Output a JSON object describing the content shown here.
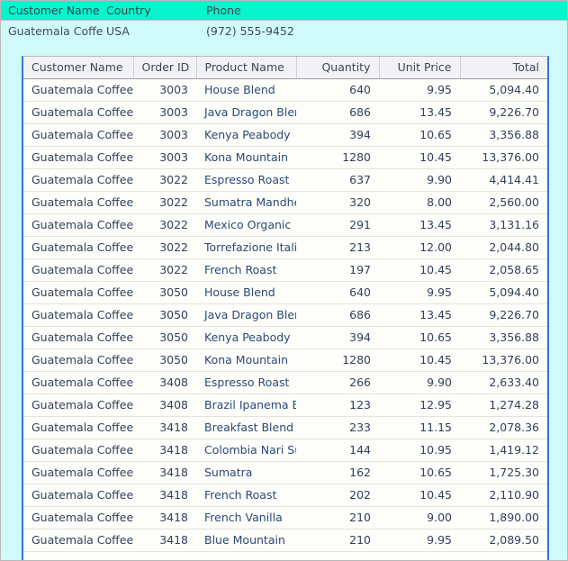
{
  "master": {
    "columns": [
      "Customer Name",
      "Country",
      "Phone"
    ],
    "row": {
      "customer_name": "Guatemala Coffee",
      "country": "USA",
      "phone": "(972) 555-9452"
    }
  },
  "detail": {
    "columns": [
      "Customer Name",
      "Order ID",
      "Product Name",
      "Quantity",
      "Unit Price",
      "Total"
    ],
    "rows": [
      {
        "customer": "Guatemala Coffee",
        "order_id": "3003",
        "product": "House Blend",
        "quantity": "640",
        "unit_price": "9.95",
        "total": "5,094.40"
      },
      {
        "customer": "Guatemala Coffee",
        "order_id": "3003",
        "product": "Java Dragon Blend",
        "quantity": "686",
        "unit_price": "13.45",
        "total": "9,226.70"
      },
      {
        "customer": "Guatemala Coffee",
        "order_id": "3003",
        "product": "Kenya Peabody",
        "quantity": "394",
        "unit_price": "10.65",
        "total": "3,356.88"
      },
      {
        "customer": "Guatemala Coffee",
        "order_id": "3003",
        "product": "Kona Mountain",
        "quantity": "1280",
        "unit_price": "10.45",
        "total": "13,376.00"
      },
      {
        "customer": "Guatemala Coffee",
        "order_id": "3022",
        "product": "Espresso Roast",
        "quantity": "637",
        "unit_price": "9.90",
        "total": "4,414.41"
      },
      {
        "customer": "Guatemala Coffee",
        "order_id": "3022",
        "product": "Sumatra Mandheli",
        "quantity": "320",
        "unit_price": "8.00",
        "total": "2,560.00"
      },
      {
        "customer": "Guatemala Coffee",
        "order_id": "3022",
        "product": "Mexico Organic",
        "quantity": "291",
        "unit_price": "13.45",
        "total": "3,131.16"
      },
      {
        "customer": "Guatemala Coffee",
        "order_id": "3022",
        "product": "Torrefazione Italia",
        "quantity": "213",
        "unit_price": "12.00",
        "total": "2,044.80"
      },
      {
        "customer": "Guatemala Coffee",
        "order_id": "3022",
        "product": "French Roast",
        "quantity": "197",
        "unit_price": "10.45",
        "total": "2,058.65"
      },
      {
        "customer": "Guatemala Coffee",
        "order_id": "3050",
        "product": "House Blend",
        "quantity": "640",
        "unit_price": "9.95",
        "total": "5,094.40"
      },
      {
        "customer": "Guatemala Coffee",
        "order_id": "3050",
        "product": "Java Dragon Blend",
        "quantity": "686",
        "unit_price": "13.45",
        "total": "9,226.70"
      },
      {
        "customer": "Guatemala Coffee",
        "order_id": "3050",
        "product": "Kenya Peabody",
        "quantity": "394",
        "unit_price": "10.65",
        "total": "3,356.88"
      },
      {
        "customer": "Guatemala Coffee",
        "order_id": "3050",
        "product": "Kona Mountain",
        "quantity": "1280",
        "unit_price": "10.45",
        "total": "13,376.00"
      },
      {
        "customer": "Guatemala Coffee",
        "order_id": "3408",
        "product": "Espresso Roast",
        "quantity": "266",
        "unit_price": "9.90",
        "total": "2,633.40"
      },
      {
        "customer": "Guatemala Coffee",
        "order_id": "3408",
        "product": "Brazil Ipanema Bo",
        "quantity": "123",
        "unit_price": "12.95",
        "total": "1,274.28"
      },
      {
        "customer": "Guatemala Coffee",
        "order_id": "3418",
        "product": "Breakfast Blend",
        "quantity": "233",
        "unit_price": "11.15",
        "total": "2,078.36"
      },
      {
        "customer": "Guatemala Coffee",
        "order_id": "3418",
        "product": "Colombia Nari Sup",
        "quantity": "144",
        "unit_price": "10.95",
        "total": "1,419.12"
      },
      {
        "customer": "Guatemala Coffee",
        "order_id": "3418",
        "product": "Sumatra",
        "quantity": "162",
        "unit_price": "10.65",
        "total": "1,725.30"
      },
      {
        "customer": "Guatemala Coffee",
        "order_id": "3418",
        "product": "French Roast",
        "quantity": "202",
        "unit_price": "10.45",
        "total": "2,110.90"
      },
      {
        "customer": "Guatemala Coffee",
        "order_id": "3418",
        "product": "French Vanilla",
        "quantity": "210",
        "unit_price": "9.00",
        "total": "1,890.00"
      },
      {
        "customer": "Guatemala Coffee",
        "order_id": "3418",
        "product": "Blue Mountain",
        "quantity": "210",
        "unit_price": "9.95",
        "total": "2,089.50"
      }
    ]
  },
  "colors": {
    "master_header_bg": "#07F5CD",
    "master_row_bg": "#D0FBFA",
    "grid_border": "#3574D4",
    "grid_header_bg": "#F2F2F5",
    "grid_row_bg": "#FDFDFA",
    "text": "#33415B",
    "product_text": "#2B4A77"
  }
}
